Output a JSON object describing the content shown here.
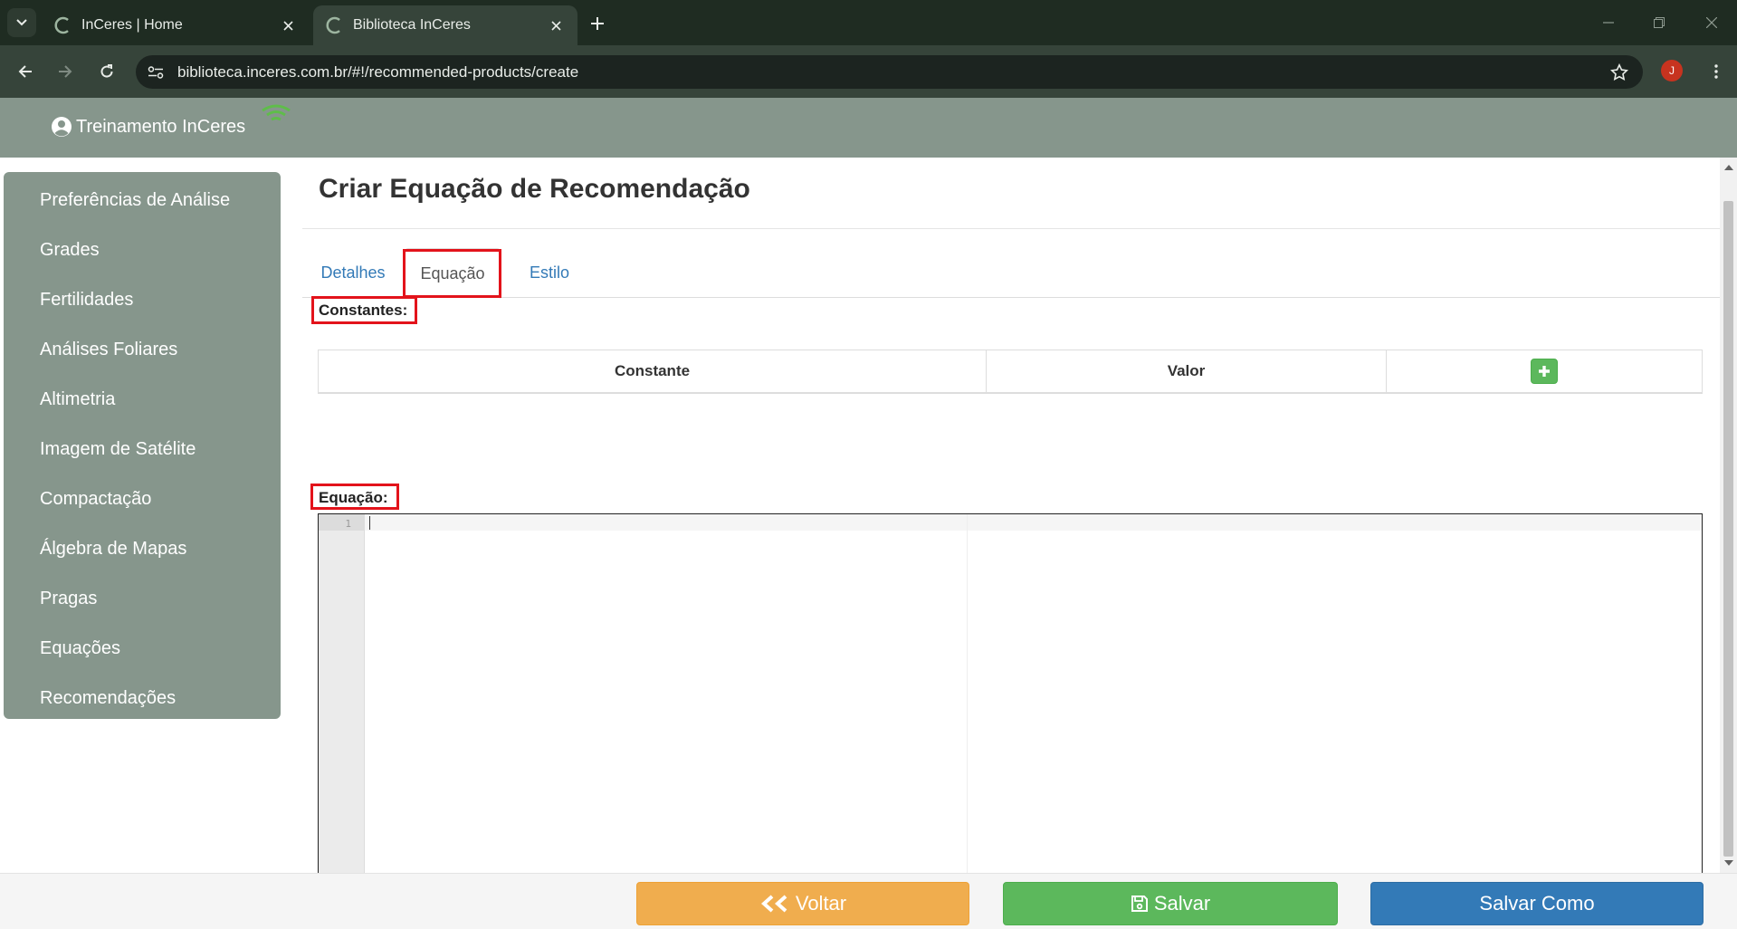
{
  "browser": {
    "tabs": [
      {
        "title": "InCeres | Home",
        "active": false
      },
      {
        "title": "Biblioteca InCeres",
        "active": true
      }
    ],
    "url": "biblioteca.inceres.com.br/#!/recommended-products/create",
    "profile_initial": "J"
  },
  "header": {
    "user_name": "Treinamento InCeres"
  },
  "sidebar": {
    "items": [
      {
        "label": "Preferências de Análise"
      },
      {
        "label": "Grades"
      },
      {
        "label": "Fertilidades"
      },
      {
        "label": "Análises Foliares"
      },
      {
        "label": "Altimetria"
      },
      {
        "label": "Imagem de Satélite"
      },
      {
        "label": "Compactação"
      },
      {
        "label": "Álgebra de Mapas"
      },
      {
        "label": "Pragas"
      },
      {
        "label": "Equações"
      },
      {
        "label": "Recomendações"
      }
    ]
  },
  "main": {
    "title": "Criar Equação de Recomendação",
    "tabs": [
      {
        "label": "Detalhes",
        "active": false
      },
      {
        "label": "Equação",
        "active": true
      },
      {
        "label": "Estilo",
        "active": false
      }
    ],
    "constants_label": "Constantes:",
    "constants_table": {
      "headers": [
        "Constante",
        "Valor"
      ],
      "add_icon": "plus-icon"
    },
    "equation_label": "Equação:",
    "editor": {
      "line_numbers": [
        "1"
      ]
    }
  },
  "footer": {
    "back_label": "Voltar",
    "save_label": "Salvar",
    "save_as_label": "Salvar Como"
  },
  "colors": {
    "sidebar_bg": "#86968c",
    "highlight": "#e3131b",
    "back_button": "#f0ad4e",
    "save_button": "#5cb85c",
    "save_as_button": "#337ab7",
    "link": "#337ab7"
  }
}
